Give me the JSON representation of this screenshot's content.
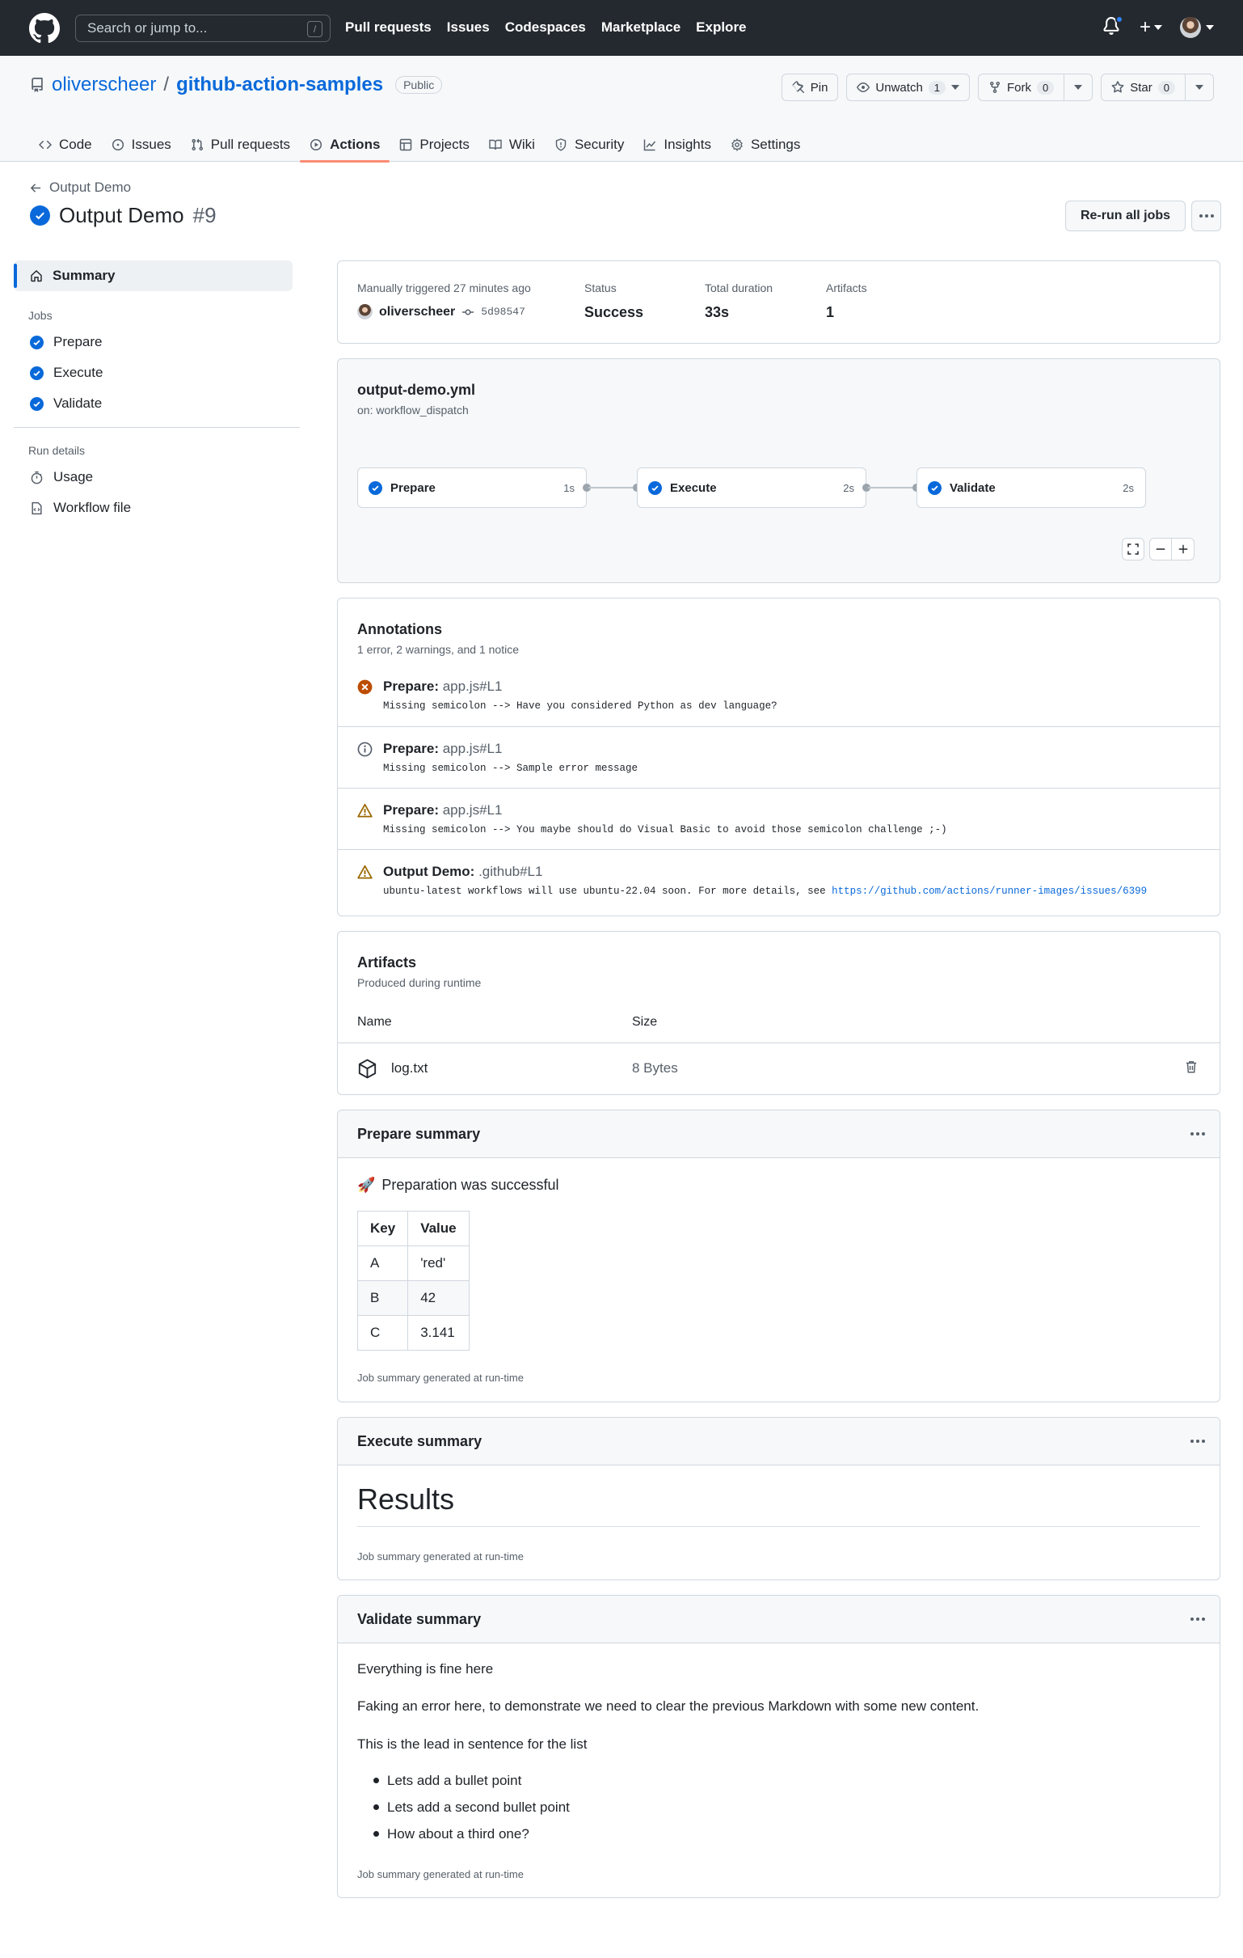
{
  "topbar": {
    "search_placeholder": "Search or jump to...",
    "search_shortcut": "/",
    "nav": [
      "Pull requests",
      "Issues",
      "Codespaces",
      "Marketplace",
      "Explore"
    ]
  },
  "repo": {
    "owner": "oliverscheer",
    "separator": "/",
    "name": "github-action-samples",
    "visibility": "Public",
    "pin_label": "Pin",
    "unwatch_label": "Unwatch",
    "watch_count": "1",
    "fork_label": "Fork",
    "fork_count": "0",
    "star_label": "Star",
    "star_count": "0",
    "tabs": [
      {
        "label": "Code",
        "icon": "code-icon"
      },
      {
        "label": "Issues",
        "icon": "issue-icon"
      },
      {
        "label": "Pull requests",
        "icon": "pull-request-icon"
      },
      {
        "label": "Actions",
        "icon": "play-icon",
        "active": true
      },
      {
        "label": "Projects",
        "icon": "table-icon"
      },
      {
        "label": "Wiki",
        "icon": "book-icon"
      },
      {
        "label": "Security",
        "icon": "shield-icon"
      },
      {
        "label": "Insights",
        "icon": "graph-icon"
      },
      {
        "label": "Settings",
        "icon": "gear-icon"
      }
    ]
  },
  "run": {
    "back_label": "Output Demo",
    "title": "Output Demo",
    "number": "#9",
    "rerun_label": "Re-run all jobs"
  },
  "sidebar": {
    "summary_label": "Summary",
    "jobs_heading": "Jobs",
    "jobs": [
      "Prepare",
      "Execute",
      "Validate"
    ],
    "run_details_heading": "Run details",
    "usage_label": "Usage",
    "workflow_file_label": "Workflow file"
  },
  "meta": {
    "trigger": "Manually triggered 27 minutes ago",
    "actor": "oliverscheer",
    "commit": "5d98547",
    "status_label": "Status",
    "status_value": "Success",
    "duration_label": "Total duration",
    "duration_value": "33s",
    "artifacts_label": "Artifacts",
    "artifacts_value": "1"
  },
  "workflow": {
    "file": "output-demo.yml",
    "trigger": "on: workflow_dispatch",
    "jobs": [
      {
        "name": "Prepare",
        "duration": "1s"
      },
      {
        "name": "Execute",
        "duration": "2s"
      },
      {
        "name": "Validate",
        "duration": "2s"
      }
    ]
  },
  "annotations": {
    "title": "Annotations",
    "subtitle": "1 error, 2 warnings, and 1 notice",
    "items": [
      {
        "type": "error",
        "job": "Prepare:",
        "path": "app.js#L1",
        "message": "Missing semicolon --> Have you considered Python as dev language?"
      },
      {
        "type": "notice",
        "job": "Prepare:",
        "path": "app.js#L1",
        "message": "Missing semicolon --> Sample error message"
      },
      {
        "type": "warning",
        "job": "Prepare:",
        "path": "app.js#L1",
        "message": "Missing semicolon --> You maybe should do Visual Basic to avoid those semicolon challenge ;-)"
      },
      {
        "type": "warning",
        "job": "Output Demo:",
        "path": ".github#L1",
        "message": "ubuntu-latest workflows will use ubuntu-22.04 soon. For more details, see ",
        "link": "https://github.com/actions/runner-images/issues/6399"
      }
    ]
  },
  "artifacts": {
    "title": "Artifacts",
    "subtitle": "Produced during runtime",
    "col_name": "Name",
    "col_size": "Size",
    "rows": [
      {
        "name": "log.txt",
        "size": "8 Bytes"
      }
    ]
  },
  "prepare_summary": {
    "title": "Prepare summary",
    "emoji": "🚀",
    "message": "Preparation was successful",
    "table_headers": [
      "Key",
      "Value"
    ],
    "table_rows": [
      [
        "A",
        "'red'"
      ],
      [
        "B",
        "42"
      ],
      [
        "C",
        "3.141"
      ]
    ],
    "footer": "Job summary generated at run-time"
  },
  "execute_summary": {
    "title": "Execute summary",
    "heading": "Results",
    "footer": "Job summary generated at run-time"
  },
  "validate_summary": {
    "title": "Validate summary",
    "p1": "Everything is fine here",
    "p2": "Faking an error here, to demonstrate we need to clear the previous Markdown with some new content.",
    "p3": "This is the lead in sentence for the list",
    "bullets": [
      "Lets add a bullet point",
      "Lets add a second bullet point",
      "How about a third one?"
    ],
    "footer": "Job summary generated at run-time"
  },
  "colors": {
    "accent": "#0969da",
    "success": "#0969da",
    "error": "#bc4c00",
    "warning": "#9a6700",
    "header_bg": "#24292f",
    "active_tab_underline": "#fd8c73"
  }
}
